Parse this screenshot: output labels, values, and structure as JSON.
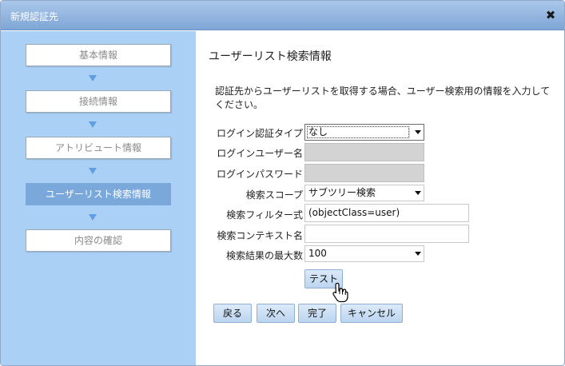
{
  "window": {
    "title": "新規認証先"
  },
  "steps": [
    {
      "label": "基本情報"
    },
    {
      "label": "接続情報"
    },
    {
      "label": "アトリビュート情報"
    },
    {
      "label": "ユーザーリスト検索情報"
    },
    {
      "label": "内容の確認"
    }
  ],
  "main": {
    "heading": "ユーザーリスト検索情報",
    "description": "認証先からユーザーリストを取得する場合、ユーザー検索用の情報を入力してください。",
    "fields": {
      "login_auth_type": {
        "label": "ログイン認証タイプ",
        "value": "なし"
      },
      "login_user": {
        "label": "ログインユーザー名",
        "value": ""
      },
      "login_password": {
        "label": "ログインパスワード",
        "value": ""
      },
      "search_scope": {
        "label": "検索スコープ",
        "value": "サブツリー検索"
      },
      "search_filter": {
        "label": "検索フィルター式",
        "value": "(objectClass=user)"
      },
      "search_context": {
        "label": "検索コンテキスト名",
        "value": ""
      },
      "max_results": {
        "label": "検索結果の最大数",
        "value": "100"
      }
    },
    "test_button": "テスト"
  },
  "footer": {
    "back": "戻る",
    "next": "次へ",
    "finish": "完了",
    "cancel": "キャンセル"
  },
  "colors": {
    "titlebar": "#7fa6d6",
    "sidebar": "#abd0f6",
    "active_step": "#7ba8da",
    "button": "#bcd5ef"
  }
}
